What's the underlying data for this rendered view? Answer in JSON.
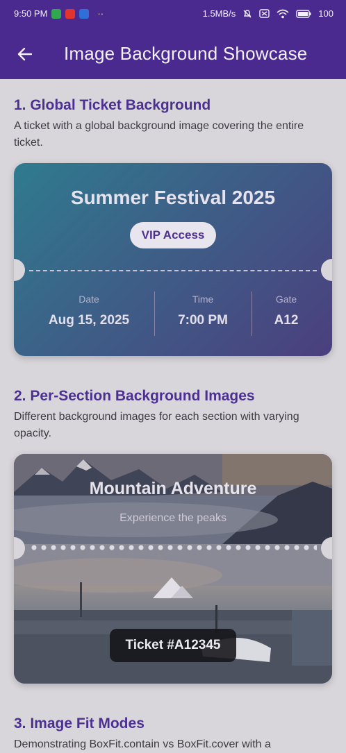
{
  "status": {
    "time": "9:50 PM",
    "dots": "··",
    "speed": "1.5MB/s",
    "battery": "100"
  },
  "app_bar": {
    "title": "Image Background Showcase"
  },
  "sections": [
    {
      "title": "1. Global Ticket Background",
      "description": "A ticket with a global background image covering the entire ticket."
    },
    {
      "title": "2. Per-Section Background Images",
      "description": "Different background images for each section with varying opacity."
    },
    {
      "title": "3. Image Fit Modes",
      "description": "Demonstrating BoxFit.contain vs BoxFit.cover with a"
    }
  ],
  "ticket1": {
    "event": "Summer Festival 2025",
    "badge": "VIP Access",
    "date_label": "Date",
    "date_value": "Aug 15, 2025",
    "time_label": "Time",
    "time_value": "7:00 PM",
    "gate_label": "Gate",
    "gate_value": "A12"
  },
  "ticket2": {
    "title": "Mountain Adventure",
    "subtitle": "Experience the peaks",
    "ticket_number": "Ticket #A12345"
  },
  "colors": {
    "primary": "#4a2a8f",
    "section_title": "#4c2f93"
  }
}
